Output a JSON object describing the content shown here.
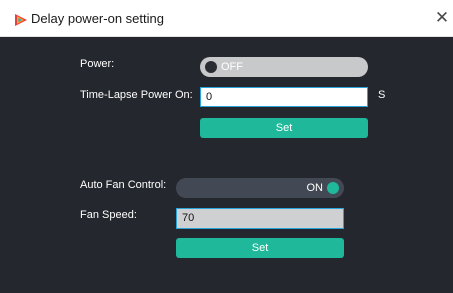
{
  "window": {
    "title": "Delay power-on setting",
    "close_glyph": "✕",
    "app_icon": "app-logo-icon"
  },
  "power_section": {
    "power_label": "Power:",
    "power_state": "OFF",
    "timelapse_label": "Time-Lapse Power On:",
    "timelapse_value": "0",
    "timelapse_unit": "S",
    "set_label": "Set"
  },
  "fan_section": {
    "auto_fan_label": "Auto Fan Control:",
    "auto_fan_state": "ON",
    "fan_speed_label": "Fan Speed:",
    "fan_speed_value": "70",
    "set_label": "Set"
  },
  "colors": {
    "panel_bg": "#24272d",
    "accent": "#1fb89a",
    "input_border": "#2aa4d8",
    "toggle_off_bg": "#c8c9cb",
    "toggle_on_bg": "#434954"
  }
}
